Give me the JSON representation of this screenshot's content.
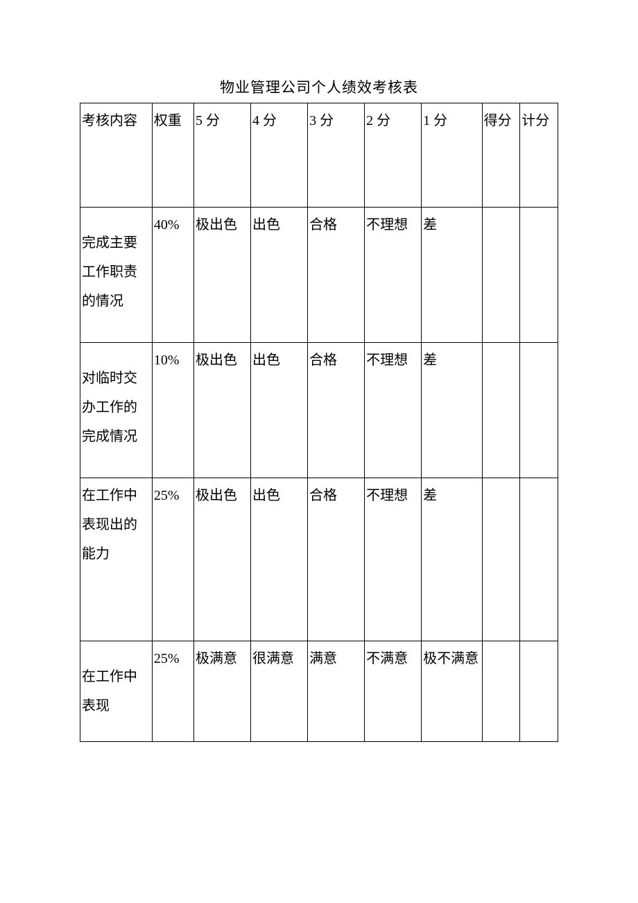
{
  "title": "物业管理公司个人绩效考核表",
  "headers": {
    "content": "考核内容",
    "weight": "权重",
    "p5": "5 分",
    "p4": "4 分",
    "p3": "3 分",
    "p2": "2 分",
    "p1": "1 分",
    "score": "得分",
    "calc": "计分"
  },
  "rows": [
    {
      "content": "完成主要工作职责的情况",
      "weight": "40%",
      "p5": "极出色",
      "p4": "出色",
      "p3": "合格",
      "p2": "不理想",
      "p1": "差",
      "score": "",
      "calc": ""
    },
    {
      "content": "对临时交办工作的完成情况",
      "weight": "10%",
      "p5": "极出色",
      "p4": "出色",
      "p3": "合格",
      "p2": "不理想",
      "p1": "差",
      "score": "",
      "calc": ""
    },
    {
      "content": "在工作中表现出的能力",
      "weight": "25%",
      "p5": "极出色",
      "p4": "出色",
      "p3": "合格",
      "p2": "不理想",
      "p1": "差",
      "score": "",
      "calc": ""
    },
    {
      "content": "在工作中表现",
      "weight": "25%",
      "p5": "极满意",
      "p4": "很满意",
      "p3": "满意",
      "p2": "不满意",
      "p1": "极不满意",
      "score": "",
      "calc": ""
    }
  ]
}
